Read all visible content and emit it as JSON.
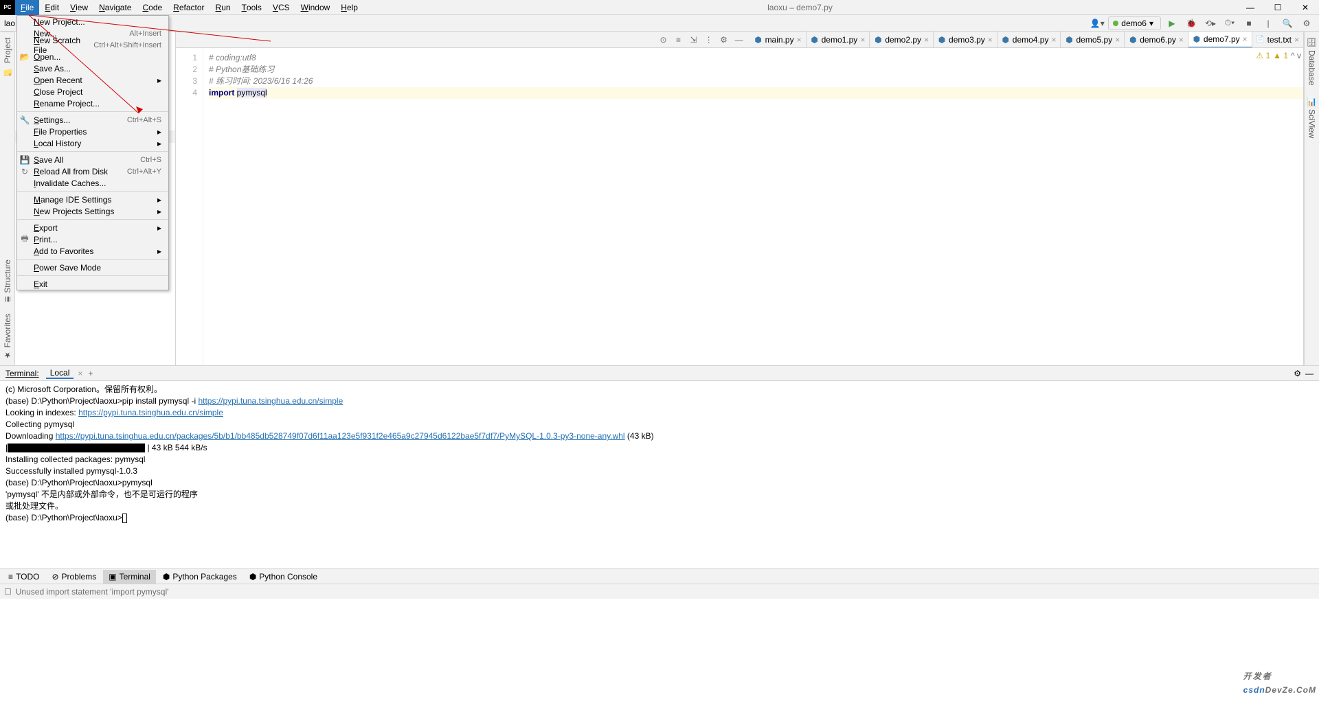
{
  "title": "laoxu – demo7.py",
  "breadcrumb_left": "lao",
  "menus": [
    "File",
    "Edit",
    "View",
    "Navigate",
    "Code",
    "Refactor",
    "Run",
    "Tools",
    "VCS",
    "Window",
    "Help"
  ],
  "dropdown": [
    {
      "label": "New Project..."
    },
    {
      "label": "New...",
      "shortcut": "Alt+Insert"
    },
    {
      "label": "New Scratch File",
      "shortcut": "Ctrl+Alt+Shift+Insert"
    },
    {
      "label": "Open...",
      "icon": "📂"
    },
    {
      "label": "Save As..."
    },
    {
      "label": "Open Recent",
      "sub": true
    },
    {
      "label": "Close Project"
    },
    {
      "label": "Rename Project..."
    },
    {
      "sep": true
    },
    {
      "label": "Settings...",
      "shortcut": "Ctrl+Alt+S",
      "icon": "🔧"
    },
    {
      "label": "File Properties",
      "sub": true
    },
    {
      "label": "Local History",
      "sub": true
    },
    {
      "sep": true
    },
    {
      "label": "Save All",
      "shortcut": "Ctrl+S",
      "icon": "💾"
    },
    {
      "label": "Reload All from Disk",
      "shortcut": "Ctrl+Alt+Y",
      "icon": "↻"
    },
    {
      "label": "Invalidate Caches..."
    },
    {
      "sep": true
    },
    {
      "label": "Manage IDE Settings",
      "sub": true
    },
    {
      "label": "New Projects Settings",
      "sub": true
    },
    {
      "sep": true
    },
    {
      "label": "Export",
      "sub": true
    },
    {
      "label": "Print...",
      "icon": "🖶"
    },
    {
      "label": "Add to Favorites",
      "sub": true
    },
    {
      "sep": true
    },
    {
      "label": "Power Save Mode"
    },
    {
      "sep": true
    },
    {
      "label": "Exit"
    }
  ],
  "run_config": "demo6",
  "tabs": [
    {
      "label": "main.py"
    },
    {
      "label": "demo1.py"
    },
    {
      "label": "demo2.py"
    },
    {
      "label": "demo3.py"
    },
    {
      "label": "demo4.py"
    },
    {
      "label": "demo5.py"
    },
    {
      "label": "demo6.py"
    },
    {
      "label": "demo7.py",
      "active": true
    },
    {
      "label": "test.txt",
      "txt": true
    }
  ],
  "code": {
    "lines": [
      "1",
      "2",
      "3",
      "4"
    ],
    "l1": "# coding:utf8",
    "l2": "# Python基础练习",
    "l3": "# 练习时间: 2023/6/16 14:26",
    "l4_kw": "import ",
    "l4_mod": "pymysql"
  },
  "editor_status": {
    "warn1": "⚠ 1",
    "warn2": "▲ 1",
    "nav": "^  v"
  },
  "left": {
    "project": "Project",
    "structure": "Structure",
    "favorites": "Favorites"
  },
  "right": {
    "database": "Database",
    "sciview": "SciView"
  },
  "terminal": {
    "header_label": "Terminal:",
    "tab": "Local",
    "lines": [
      {
        "t": "(c) Microsoft Corporation。保留所有权利。"
      },
      {
        "t": ""
      },
      {
        "prefix": "(base) D:\\Python\\Project\\laoxu>pip install pymysql -i ",
        "url": "https://pypi.tuna.tsinghua.edu.cn/simple"
      },
      {
        "prefix": "Looking in indexes: ",
        "url": "https://pypi.tuna.tsinghua.edu.cn/simple"
      },
      {
        "t": "Collecting pymysql"
      },
      {
        "prefix": "  Downloading ",
        "url": "https://pypi.tuna.tsinghua.edu.cn/packages/5b/b1/bb485db528749f07d6f11aa123e5f931f2e465a9c27945d6122bae5f7df7/PyMySQL-1.0.3-py3-none-any.whl",
        "suffix": " (43 kB)"
      },
      {
        "prog": true,
        "t": " | 43 kB 544 kB/s"
      },
      {
        "t": "Installing collected packages: pymysql"
      },
      {
        "t": "Successfully installed pymysql-1.0.3"
      },
      {
        "t": ""
      },
      {
        "t": "(base) D:\\Python\\Project\\laoxu>pymysql"
      },
      {
        "t": "'pymysql' 不是内部或外部命令，也不是可运行的程序"
      },
      {
        "t": "或批处理文件。"
      },
      {
        "t": ""
      },
      {
        "prompt": "(base) D:\\Python\\Project\\laoxu>"
      }
    ]
  },
  "bottom_tabs": [
    {
      "icon": "≡",
      "label": "TODO"
    },
    {
      "icon": "⊘",
      "label": "Problems"
    },
    {
      "icon": "▣",
      "label": "Terminal",
      "active": true
    },
    {
      "icon": "⬢",
      "label": "Python Packages"
    },
    {
      "icon": "⬢",
      "label": "Python Console"
    }
  ],
  "status": "Unused import statement 'import pymysql'",
  "watermark": {
    "big": "开发者",
    "small": "DevZe.CoM"
  }
}
